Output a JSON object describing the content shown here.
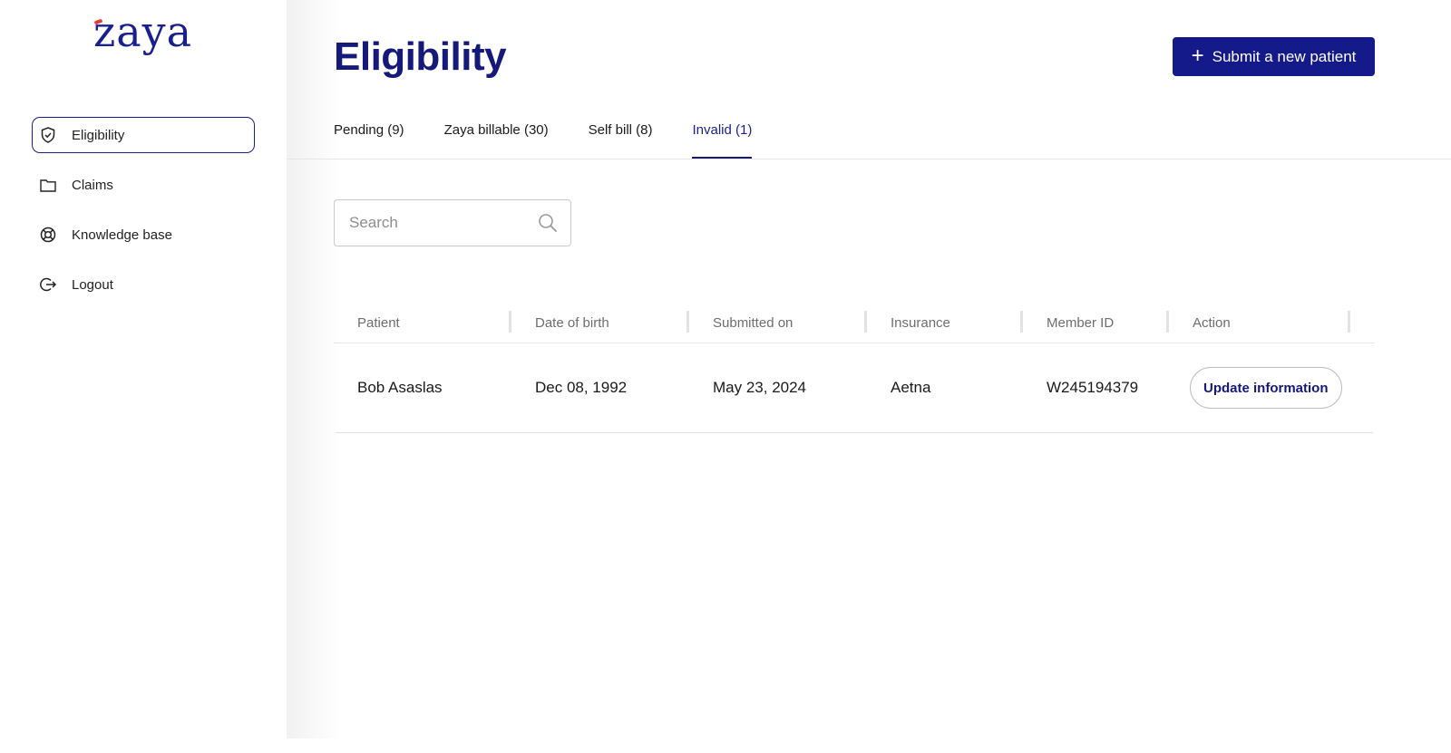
{
  "brand": {
    "logo_text": "zaya",
    "primary_color": "#15197a",
    "accent_color": "#e23a3a"
  },
  "sidebar": {
    "items": [
      {
        "label": "Eligibility",
        "icon": "shield-check-icon",
        "active": true
      },
      {
        "label": "Claims",
        "icon": "folder-icon",
        "active": false
      },
      {
        "label": "Knowledge base",
        "icon": "lifebuoy-icon",
        "active": false
      },
      {
        "label": "Logout",
        "icon": "logout-icon",
        "active": false
      }
    ]
  },
  "header": {
    "title": "Eligibility",
    "submit_label": "Submit a new patient"
  },
  "tabs": [
    {
      "label": "Pending (9)",
      "active": false
    },
    {
      "label": "Zaya billable (30)",
      "active": false
    },
    {
      "label": "Self bill (8)",
      "active": false
    },
    {
      "label": "Invalid (1)",
      "active": true
    }
  ],
  "search": {
    "placeholder": "Search",
    "value": ""
  },
  "table": {
    "columns": [
      "Patient",
      "Date of birth",
      "Submitted on",
      "Insurance",
      "Member ID",
      "Action"
    ],
    "rows": [
      {
        "patient": "Bob Asaslas",
        "dob": "Dec 08, 1992",
        "submitted": "May 23, 2024",
        "insurance": "Aetna",
        "member_id": "W245194379",
        "action_label": "Update information"
      }
    ]
  }
}
